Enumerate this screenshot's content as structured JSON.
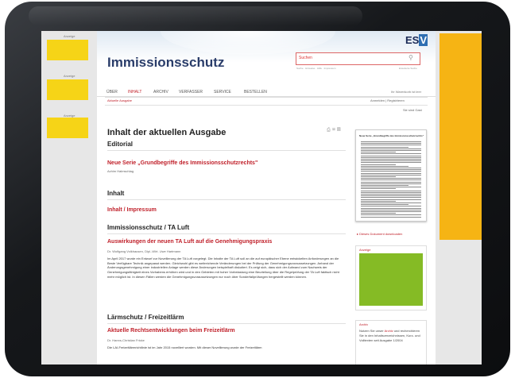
{
  "ads": {
    "label": "Anzeige",
    "right_color": "#f6b414",
    "left_color": "#f6d417"
  },
  "header": {
    "site_title": "Immissionsschutz",
    "logo_es": "ES",
    "logo_y": "V",
    "search_placeholder": "Suchen",
    "search_links": "Suche · Hinweise · Hilfe · Impressum",
    "search_advanced": "Erweiterte Suche"
  },
  "nav": {
    "items": [
      "ÜBER",
      "INHALT",
      "ARCHIV",
      "VERFASSER",
      "SERVICE",
      "BESTELLEN"
    ],
    "active": "INHALT",
    "right_text": "Ihr Warenkorb ist leer"
  },
  "subnav": {
    "current": "Aktuelle Ausgabe",
    "login": "Anmelden | Registrieren",
    "location": "Sie sind Gast"
  },
  "main": {
    "heading": "Inhalt der aktuellen Ausgabe",
    "tools_icons": [
      "print-icon",
      "share-icon",
      "pdf-icon"
    ],
    "sections": [
      {
        "title": "Editorial",
        "articles": [
          {
            "title": "Neue Serie „Grundbegriffe des Immissionsschutzrechts\"",
            "author": "Achim Halmschlag"
          }
        ]
      },
      {
        "title": "Inhalt",
        "articles": [
          {
            "title": "Inhalt / Impressum",
            "author": ""
          }
        ]
      },
      {
        "title": "Immissionsschutz / TA Luft",
        "articles": [
          {
            "title": "Auswirkungen der neuen TA Luft auf die Genehmigungspraxis",
            "author": "Dr. Wolfgang Volkhausen, Dipl.-Wirt. Uwe Hartmann",
            "body": "Im April 2017 wurde ein Entwurf zur Novellierung der TA Luft vorgelegt. Die Inhalte der TA Luft soll an die auf europäischer Ebene entwickelten Anforderungen an die Beste Verfügbare Technik angepasst werden. Gleichwohl gibt es weitreichende Veränderungen bei der Prüfung der Genehmigungsvoraussetzungen. Anhand der Änderungsgenehmigung einer industriellen Anlage werden diese Änderungen beispielhaft diskutiert. Es zeigt sich, dass sich der Aufwand zum Nachweis der Genehmigungsfähigkeit eines Vorhabens erhöhen wird und in den Gebieten mit hoher Vorbelastung eine Beurteilung über die Regelprüfung der TA Luft faktisch nicht mehr möglich ist. In diesen Fällen werden die Genehmigungsvoraussetzungen nur noch über Sonderfallprüfungen hergestellt werden können."
          }
        ]
      },
      {
        "title": "Lärmschutz / Freizeitlärm",
        "articles": [
          {
            "title": "Aktuelle Rechtsentwicklungen beim Freizeitlärm",
            "author": "Dr. Hanns-Christian Fricke",
            "body": "Die LAI-Freizeitlärmrichtlinie ist im Jahr 2015 novelliert worden. Mit dieser Novellierung wurde der Freizeitlärm"
          }
        ]
      }
    ]
  },
  "sidebar": {
    "thumb_title": "Neue Serie „Grundbegriffe des Immissionsschutzrechts\"",
    "download_link": "▸ Dieses Dokument downloaden",
    "ad_box_label": "Anzeige",
    "ad_box_color": "#85bb25",
    "archive": {
      "label": "Archiv",
      "text_before": "Nutzen Sie unser ",
      "link": "Archiv",
      "text_after": " und recherchieren Sie in den Inhaltsverzeichnissen, Kurz- und Volltexten seit Ausgabe 1/2004"
    }
  }
}
